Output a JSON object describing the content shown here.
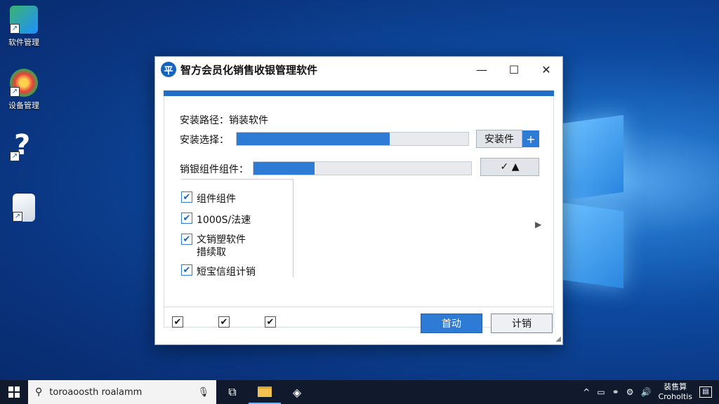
{
  "desktop": {
    "icons": [
      {
        "label": "软件管理",
        "icon": "app-shortcut-icon"
      },
      {
        "label": "设备管理",
        "icon": "browser-shortcut-icon"
      },
      {
        "label": "",
        "icon": "help-shortcut-icon"
      },
      {
        "label": "",
        "icon": "document-shortcut-icon"
      }
    ]
  },
  "dialog": {
    "app_icon_text": "平",
    "title": "智方会员化销售收银管理软件",
    "controls": {
      "minimize": "—",
      "maximize": "☐",
      "close": "✕"
    },
    "install_path_label": "安装路径：",
    "install_path_value": "销装软件",
    "install_option_label": "安装选择：",
    "install_option_progress": 0.66,
    "install_button": "安装件",
    "install_plus": "+",
    "component_label": "销银组件组件：",
    "component_progress": 0.28,
    "component_button_icons": "✓ ▲",
    "checkboxes": [
      {
        "label": "组件组件",
        "checked": true
      },
      {
        "label": "1000S/法速",
        "checked": true
      },
      {
        "label": "文销塑软件\n措续取",
        "checked": true
      },
      {
        "label": "短宝信组计销",
        "checked": true
      }
    ],
    "expand_arrow": "▶",
    "footer_checkboxes": [
      true,
      true,
      true
    ],
    "primary_button": "首动",
    "secondary_button": "计销",
    "accent_color": "#2e7bd6"
  },
  "taskbar": {
    "search_text": "toroaoosth roalamm",
    "clock_line1": "装售算",
    "clock_line2": "Croholtis"
  }
}
